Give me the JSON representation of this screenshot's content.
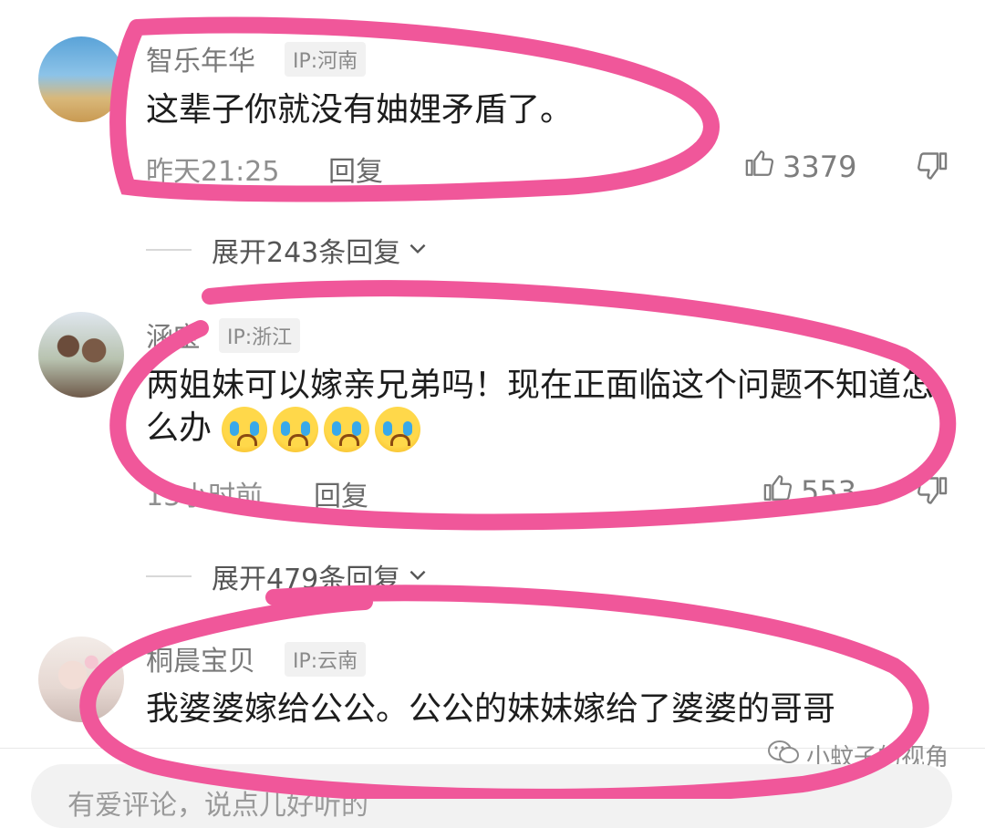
{
  "comments": [
    {
      "username": "智乐年华",
      "ip": "IP:河南",
      "text": "这辈子你就没有妯娌矛盾了。",
      "time": "昨天21:25",
      "reply_label": "回复",
      "likes": "3379",
      "expand_label": "展开243条回复"
    },
    {
      "username": "涵宝",
      "ip": "IP:浙江",
      "text": "两姐妹可以嫁亲兄弟吗！现在正面临这个问题不知道怎么办",
      "emoji_count": 4,
      "time": "13小时前",
      "reply_label": "回复",
      "likes": "553",
      "expand_label": "展开479条回复"
    },
    {
      "username": "桐晨宝贝",
      "ip": "IP:云南",
      "text": "我婆婆嫁给公公。公公的妹妹嫁给了婆婆的哥哥"
    }
  ],
  "input": {
    "placeholder": "有爱评论，说点儿好听的"
  },
  "watermark": {
    "text": "小蚊子的视角"
  },
  "colors": {
    "annotation": "#f0579a",
    "text_primary": "#1d1d1d",
    "text_secondary": "#8f8f8f"
  }
}
